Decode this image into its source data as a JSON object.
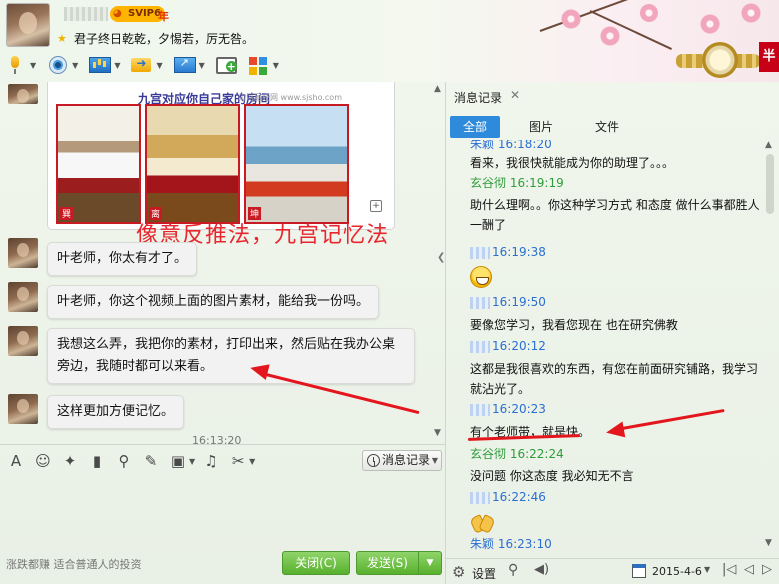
{
  "header": {
    "vip_label": "SVIP6",
    "year_label": "年",
    "signature": "君子终日乾乾，夕惕若，厉无咎。",
    "ad_corner_text": "半"
  },
  "toolbar": {
    "icons": [
      "microphone-icon",
      "webcam-icon",
      "screen-share-icon",
      "send-file-icon",
      "remote-desktop-icon",
      "new-message-icon",
      "apps-icon"
    ]
  },
  "chat": {
    "image_title": "九宫对应你自己家的房间",
    "image_subtitle": "山河易经网 www.sjsho.com",
    "room_labels": [
      "巽",
      "离",
      "坤"
    ],
    "overlay_caption": "像意反推法，九宫记忆法",
    "messages": [
      "叶老师，你太有才了。",
      "叶老师，你这个视频上面的图片素材，能给我一份吗。",
      "我想这么弄，我把你的素材，打印出来，然后贴在我办公桌旁边，我随时都可以来看。",
      "这样更加方便记忆。"
    ],
    "partial_time": "16:13:20"
  },
  "input_tools": {
    "icons": [
      "font-icon",
      "emoji-icon",
      "magic-icon",
      "video-clip-icon",
      "voice-icon",
      "edit-icon",
      "image-icon",
      "music-icon",
      "screenshot-icon"
    ]
  },
  "history_button": "消息记录",
  "bottom": {
    "ad_text": "涨跌都赚  适合普通人的投资",
    "close_label": "关闭(C)",
    "send_label": "发送(S)"
  },
  "panel": {
    "tab_label": "消息记录",
    "filters": [
      "全部",
      "图片",
      "文件"
    ],
    "entries": [
      {
        "type": "header",
        "name": "朱颖",
        "time": "16:18:20",
        "color": "blue"
      },
      {
        "type": "text",
        "text": "看来，我很快就能成为你的助理了。。。"
      },
      {
        "type": "header",
        "name": "玄谷彻",
        "time": "16:19:19",
        "color": "green"
      },
      {
        "type": "text",
        "text": "助什么理啊。。你这种学习方式  和态度   做什么事都胜人一酬了"
      },
      {
        "type": "header",
        "name": "朱颖",
        "time": "16:19:38",
        "color": "blue"
      },
      {
        "type": "emoji",
        "emoji": "grin-emoji"
      },
      {
        "type": "header",
        "name": "朱颖",
        "time": "16:19:50",
        "color": "blue"
      },
      {
        "type": "text",
        "text": "要像您学习，我看您现在 也在研究佛教"
      },
      {
        "type": "header",
        "name": "朱颖",
        "time": "16:20:12",
        "color": "blue"
      },
      {
        "type": "text",
        "text": "这都是我很喜欢的东西，有您在前面研究铺路，我学习就沾光了。"
      },
      {
        "type": "header",
        "name": "朱颖",
        "time": "16:20:23",
        "color": "blue"
      },
      {
        "type": "text",
        "text": "有个老师带，就是快。"
      },
      {
        "type": "header",
        "name": "玄谷彻",
        "time": "16:22:24",
        "color": "green"
      },
      {
        "type": "text",
        "text": "没问题  你这态度  我必知无不言"
      },
      {
        "type": "header",
        "name": "朱颖",
        "time": "16:22:46",
        "color": "blue"
      },
      {
        "type": "emoji",
        "emoji": "pray-emoji"
      },
      {
        "type": "header",
        "name": "朱颖",
        "time": "16:23:10",
        "color": "blue"
      }
    ],
    "settings_label": "设置",
    "date_label": "2015-4-6"
  },
  "colors": {
    "accent_blue": "#2e8bdc",
    "send_green": "#58b12d",
    "annotation_red": "#e4161d",
    "name_green": "#2e9c3a",
    "name_blue": "#2a6fd1"
  }
}
